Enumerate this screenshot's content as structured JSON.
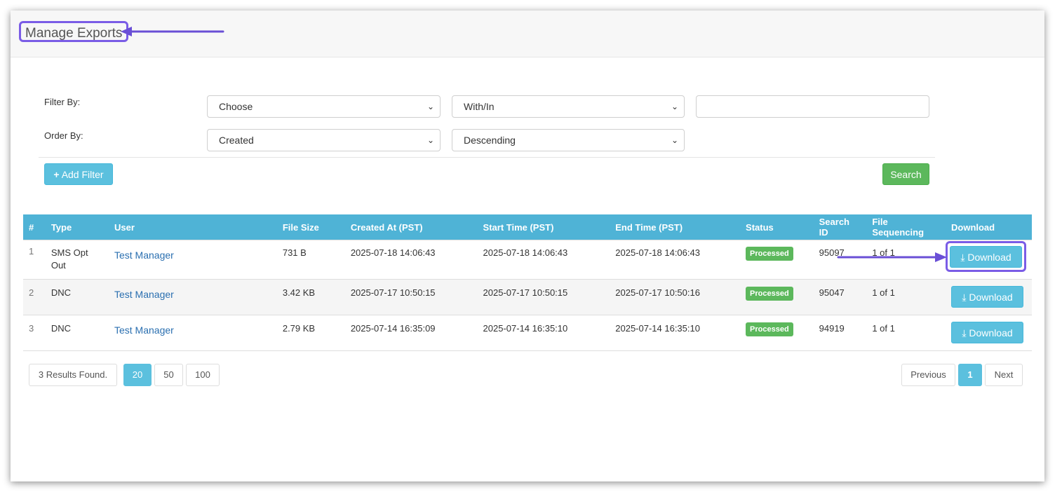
{
  "page": {
    "title": "Manage Exports"
  },
  "filters": {
    "filter_label": "Filter By:",
    "order_label": "Order By:",
    "filter_field": "Choose",
    "filter_operator": "With/In",
    "filter_value": "",
    "order_field": "Created",
    "order_direction": "Descending",
    "add_filter_label": "Add Filter",
    "search_label": "Search"
  },
  "table": {
    "headers": [
      "#",
      "Type",
      "User",
      "File Size",
      "Created At (PST)",
      "Start Time (PST)",
      "End Time (PST)",
      "Status",
      "Search ID",
      "File Sequencing",
      "Download"
    ],
    "rows": [
      {
        "num": "1",
        "type": "SMS Opt Out",
        "user": "Test Manager",
        "size": "731 B",
        "created": "2025-07-18 14:06:43",
        "start": "2025-07-18 14:06:43",
        "end": "2025-07-18 14:06:43",
        "status": "Processed",
        "search_id": "95097",
        "sequencing": "1 of 1",
        "download": "Download"
      },
      {
        "num": "2",
        "type": "DNC",
        "user": "Test Manager",
        "size": "3.42 KB",
        "created": "2025-07-17 10:50:15",
        "start": "2025-07-17 10:50:15",
        "end": "2025-07-17 10:50:16",
        "status": "Processed",
        "search_id": "95047",
        "sequencing": "1 of 1",
        "download": "Download"
      },
      {
        "num": "3",
        "type": "DNC",
        "user": "Test Manager",
        "size": "2.79 KB",
        "created": "2025-07-14 16:35:09",
        "start": "2025-07-14 16:35:10",
        "end": "2025-07-14 16:35:10",
        "status": "Processed",
        "search_id": "94919",
        "sequencing": "1 of 1",
        "download": "Download"
      }
    ]
  },
  "pagination": {
    "results_text": "3 Results Found.",
    "page_sizes": [
      "20",
      "50",
      "100"
    ],
    "active_page_size": "20",
    "previous_label": "Previous",
    "current_page": "1",
    "next_label": "Next"
  },
  "colors": {
    "accent": "#5bc0de",
    "table_header": "#4fb3d6",
    "success": "#5cb85c",
    "annotation": "#7a5ce6",
    "link": "#2a6fb0"
  },
  "icons": {
    "add": "plus-icon",
    "download": "download-icon",
    "select": "chevron-down-icon"
  }
}
